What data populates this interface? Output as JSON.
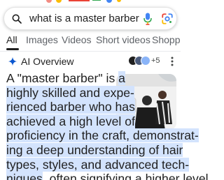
{
  "search": {
    "query": "what is a master barber"
  },
  "tabs": [
    {
      "label": "All",
      "active": true
    },
    {
      "label": "Images",
      "active": false
    },
    {
      "label": "Videos",
      "active": false
    },
    {
      "label": "Short videos",
      "active": false
    },
    {
      "label": "Shoppi",
      "active": false
    }
  ],
  "ai_overview": {
    "title": "AI Overview",
    "source_count": "+5",
    "lines": [
      {
        "plain": "A \"master barber\" is ",
        "highlighted": "a"
      },
      {
        "plain": "",
        "highlighted": "highly skilled and expe-"
      },
      {
        "plain": "",
        "highlighted": "rienced barber who has"
      },
      {
        "plain": "",
        "highlighted": "achieved a high level of"
      },
      {
        "plain": "",
        "highlighted": "proficiency in the craft, demonstrat-"
      },
      {
        "plain": "",
        "highlighted": "ing a deep understanding of hair"
      },
      {
        "plain": "",
        "highlighted": "types, styles, and advanced tech-"
      },
      {
        "plain": "niques, often signifying a higher level",
        "highlighted": "",
        "highlight_first": "niques"
      }
    ]
  },
  "colors": {
    "accent_blue": "#0b57d0",
    "highlight": "#d3e3fd",
    "text": "#1f1f1f",
    "muted": "#5f6368"
  },
  "icons": {
    "search": "search-icon",
    "mic": "microphone-icon",
    "lens": "google-lens-icon",
    "sparkle": "ai-sparkle-icon",
    "more": "more-vert-icon"
  }
}
